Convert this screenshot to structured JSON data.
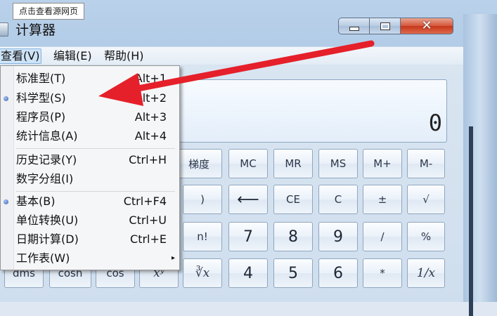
{
  "tooltip": "点击查看源网页",
  "window": {
    "title": "计算器",
    "close_glyph": "✕"
  },
  "menubar": {
    "view": "查看(V)",
    "edit": "编辑(E)",
    "help": "帮助(H)"
  },
  "view_menu": [
    {
      "label": "标准型(T)",
      "shortcut": "Alt+1",
      "selected": false
    },
    {
      "label": "科学型(S)",
      "shortcut": "Alt+2",
      "selected": true
    },
    {
      "label": "程序员(P)",
      "shortcut": "Alt+3",
      "selected": false
    },
    {
      "label": "统计信息(A)",
      "shortcut": "Alt+4",
      "selected": false
    },
    {
      "label": "历史记录(Y)",
      "shortcut": "Ctrl+H",
      "selected": false
    },
    {
      "label": "数字分组(I)",
      "shortcut": "",
      "selected": false
    },
    {
      "label": "基本(B)",
      "shortcut": "Ctrl+F4",
      "selected": true
    },
    {
      "label": "单位转换(U)",
      "shortcut": "Ctrl+U",
      "selected": false
    },
    {
      "label": "日期计算(D)",
      "shortcut": "Ctrl+E",
      "selected": false
    },
    {
      "label": "工作表(W)",
      "shortcut": "",
      "selected": false,
      "submenu": "▸"
    }
  ],
  "display": {
    "value": "0"
  },
  "keys": {
    "grad": "梯度",
    "mc": "MC",
    "mr": "MR",
    "ms": "MS",
    "mplus": "M+",
    "mminus": "M-",
    "rparen": ")",
    "back": "⟵",
    "ce": "CE",
    "c": "C",
    "plusminus": "±",
    "sqrt": "√",
    "fact": "n!",
    "seven": "7",
    "eight": "8",
    "nine": "9",
    "div": "/",
    "pct": "%",
    "dms": "dms",
    "cosh": "cosh",
    "cos": "cos",
    "xy": "xʸ",
    "yroot": "∛x",
    "four": "4",
    "five": "5",
    "six": "6",
    "mul": "*",
    "recip": "1/x"
  },
  "colors": {
    "arrow": "#e5202a"
  }
}
